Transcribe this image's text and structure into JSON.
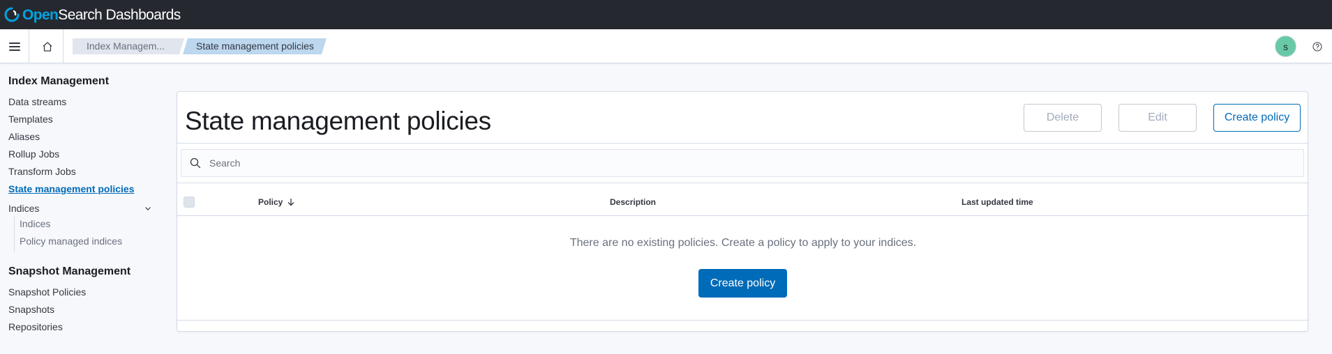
{
  "header": {
    "brand_open": "Open",
    "brand_rest": "Search Dashboards",
    "logo_icon": "opensearch-logo-icon",
    "bg_color": "#25282f"
  },
  "subheader": {
    "menu_icon": "hamburger-menu-icon",
    "home_icon": "home-icon",
    "breadcrumbs": [
      {
        "label": "Index Managem..."
      },
      {
        "label": "State management policies"
      }
    ],
    "avatar_initial": "s",
    "avatar_color": "#68c9a6",
    "help_icon": "help-icon"
  },
  "sidebar": {
    "index_management": {
      "heading": "Index Management",
      "items": [
        {
          "label": "Data streams"
        },
        {
          "label": "Templates"
        },
        {
          "label": "Aliases"
        },
        {
          "label": "Rollup Jobs"
        },
        {
          "label": "Transform Jobs"
        },
        {
          "label": "State management policies",
          "active": true
        },
        {
          "label": "Indices",
          "expandable": true
        }
      ],
      "subitems": [
        {
          "label": "Indices"
        },
        {
          "label": "Policy managed indices"
        }
      ]
    },
    "snapshot_management": {
      "heading": "Snapshot Management",
      "items": [
        {
          "label": "Snapshot Policies"
        },
        {
          "label": "Snapshots"
        },
        {
          "label": "Repositories"
        }
      ]
    }
  },
  "main": {
    "title": "State management policies",
    "buttons": {
      "delete": "Delete",
      "edit": "Edit",
      "create": "Create policy"
    },
    "search": {
      "placeholder": "Search",
      "value": ""
    },
    "table": {
      "columns": [
        {
          "label": "Policy",
          "sort": "descending"
        },
        {
          "label": "Description"
        },
        {
          "label": "Last updated time"
        }
      ],
      "rows": [],
      "empty_message": "There are no existing policies. Create a policy to apply to your indices.",
      "empty_action": "Create policy"
    },
    "accent_color": "#006bb8"
  }
}
